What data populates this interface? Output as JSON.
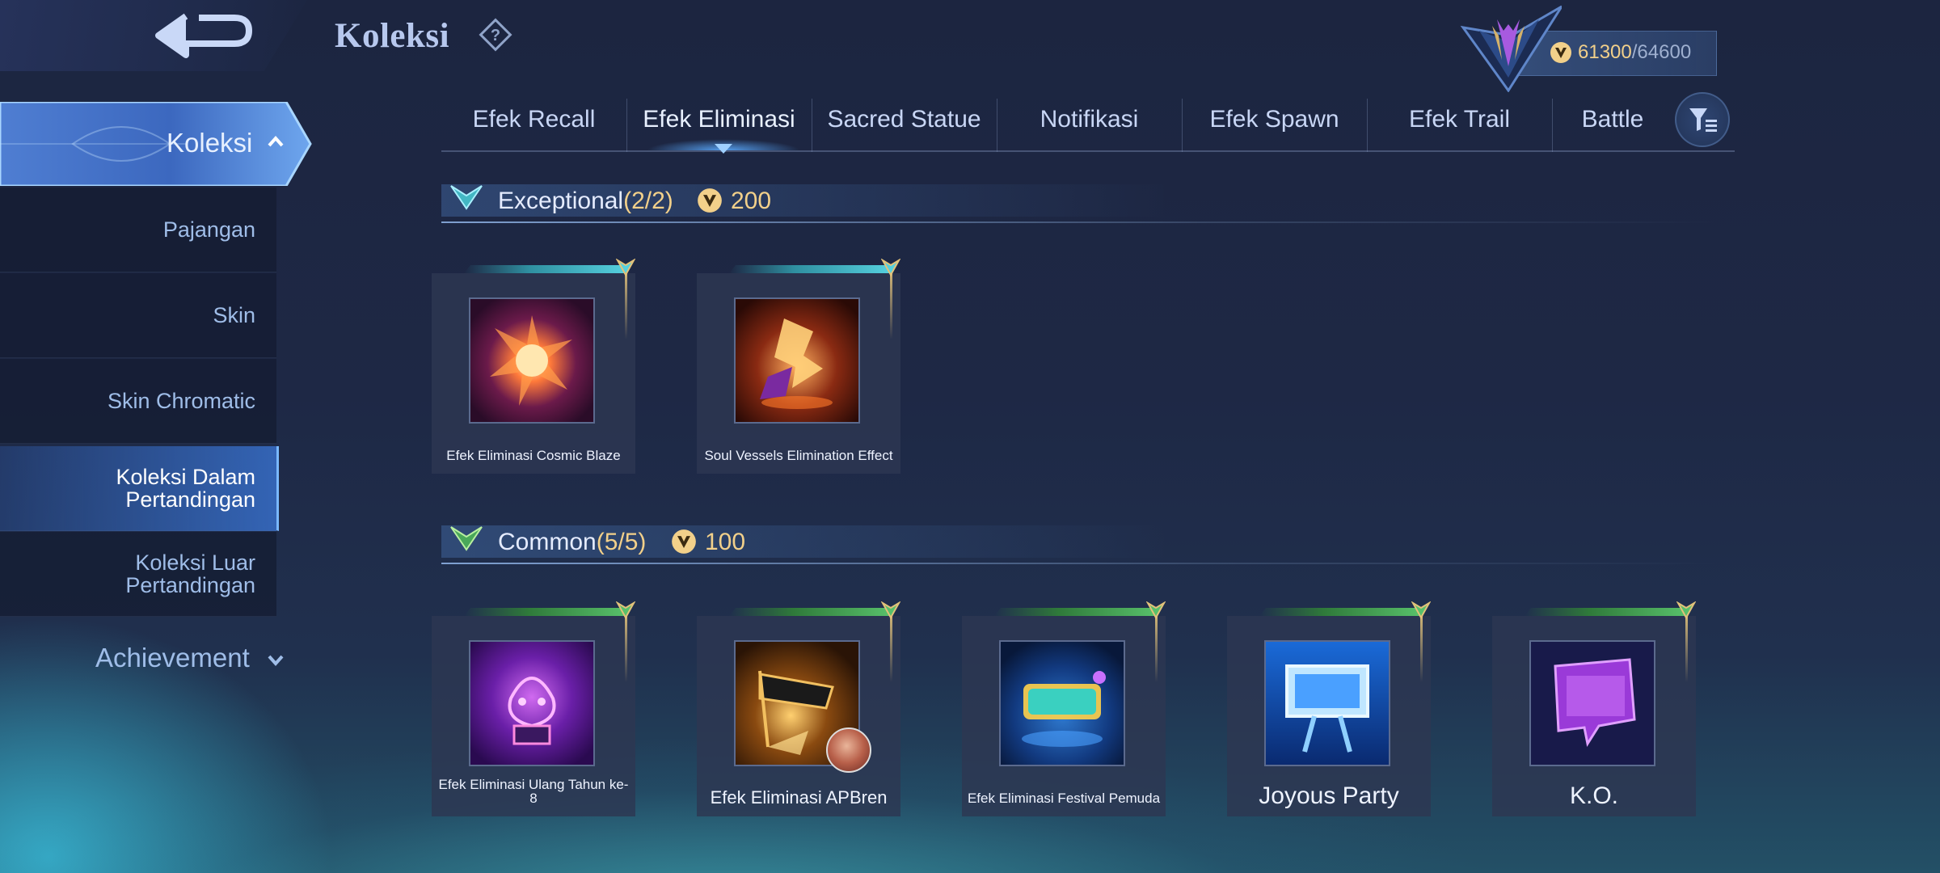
{
  "header": {
    "title": "Koleksi",
    "back_icon": "back-arrow-icon",
    "help_icon": "question-diamond-icon"
  },
  "points": {
    "current": "61300",
    "separator": "/",
    "total": "64600",
    "icon": "coin-icon"
  },
  "tabs": [
    {
      "label": "Efek Recall",
      "active": false
    },
    {
      "label": "Efek Eliminasi",
      "active": true
    },
    {
      "label": "Sacred Statue",
      "active": false
    },
    {
      "label": "Notifikasi",
      "active": false
    },
    {
      "label": "Efek Spawn",
      "active": false
    },
    {
      "label": "Efek Trail",
      "active": false
    },
    {
      "label": "Battle",
      "active": false
    }
  ],
  "sidebar": {
    "active_group": "Koleksi",
    "items": [
      {
        "label": "Pajangan",
        "selected": false
      },
      {
        "label": "Skin",
        "selected": false
      },
      {
        "label": "Skin Chromatic",
        "selected": false
      },
      {
        "label": "Koleksi Dalam Pertandingan",
        "selected": true
      },
      {
        "label": "Koleksi Luar Pertandingan",
        "selected": false
      }
    ],
    "achievement": "Achievement"
  },
  "sections": [
    {
      "name": "Exceptional",
      "count": "(2/2)",
      "points": "200",
      "accent": "#43b7c4",
      "items": [
        {
          "name": "Efek Eliminasi Cosmic Blaze"
        },
        {
          "name": "Soul Vessels Elimination Effect"
        }
      ]
    },
    {
      "name": "Common",
      "count": "(5/5)",
      "points": "100",
      "accent": "#4aa85a",
      "items": [
        {
          "name": "Efek Eliminasi Ulang Tahun ke-8"
        },
        {
          "name": "Efek Eliminasi APBren"
        },
        {
          "name": "Efek Eliminasi Festival Pemuda"
        },
        {
          "name": "Joyous Party"
        },
        {
          "name": "K.O."
        }
      ]
    }
  ],
  "colors": {
    "gold": "#f2d08a",
    "tab_text": "#c8d6f5",
    "sidebar_text": "#9fbde8"
  }
}
